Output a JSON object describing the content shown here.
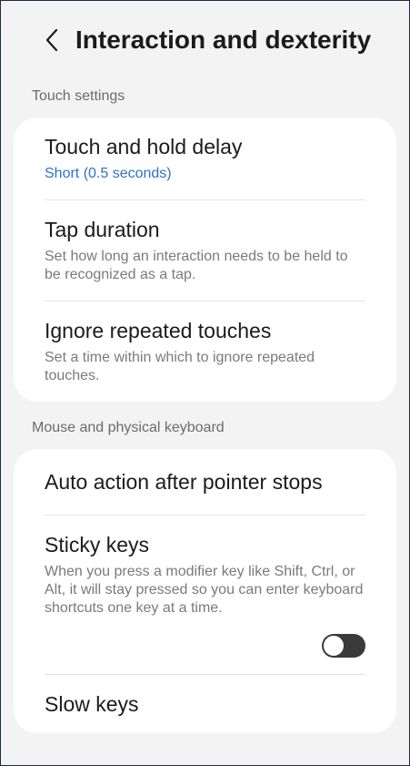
{
  "header": {
    "back_icon": "chevron-left-icon",
    "title": "Interaction and dexterity"
  },
  "sections": {
    "touch": {
      "label": "Touch settings",
      "items": [
        {
          "title": "Touch and hold delay",
          "subtitle": "Short (0.5 seconds)"
        },
        {
          "title": "Tap duration",
          "subtitle": "Set how long an interaction needs to be held to be recognized as a tap."
        },
        {
          "title": "Ignore repeated touches",
          "subtitle": "Set a time within which to ignore repeated touches."
        }
      ]
    },
    "mouse": {
      "label": "Mouse and physical keyboard",
      "items": [
        {
          "title": "Auto action after pointer stops"
        },
        {
          "title": "Sticky keys",
          "subtitle": "When you press a modifier key like Shift, Ctrl, or Alt, it will stay pressed so you can enter keyboard shortcuts one key at a time.",
          "toggle_on": false
        },
        {
          "title": "Slow keys"
        }
      ]
    }
  },
  "colors": {
    "accent": "#2f6fcf",
    "background": "#f3f3f3",
    "card": "#ffffff"
  }
}
